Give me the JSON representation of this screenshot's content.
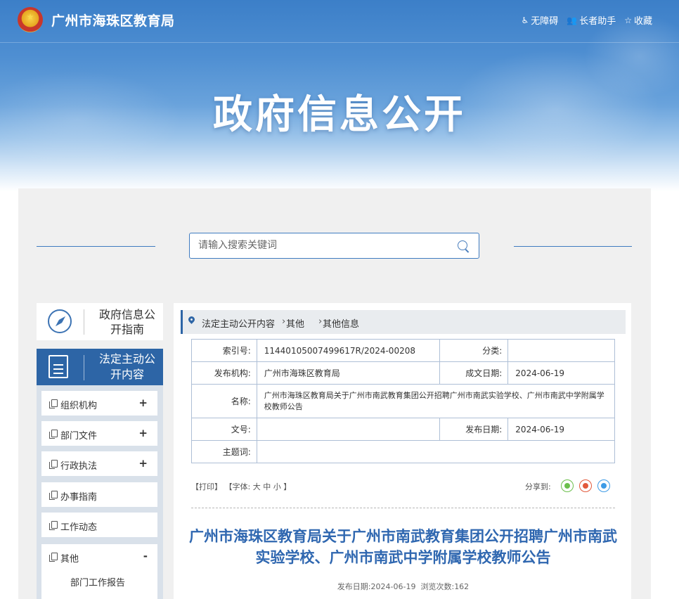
{
  "header": {
    "site_title": "广州市海珠区教育局",
    "links": [
      {
        "icon": "wheelchair-icon",
        "glyph": "♿",
        "label": "无障碍"
      },
      {
        "icon": "elder-helper-icon",
        "glyph": "👥",
        "label": "长者助手"
      },
      {
        "icon": "star-icon",
        "glyph": "☆",
        "label": "收藏"
      }
    ],
    "banner_title": "政府信息公开"
  },
  "search": {
    "placeholder": "请输入搜索关键词",
    "value": ""
  },
  "sidebar": {
    "guide_label": "政府信息公开指南",
    "active_label": "法定主动公开内容",
    "items": [
      {
        "label": "组织机构",
        "toggle": "+"
      },
      {
        "label": "部门文件",
        "toggle": "+"
      },
      {
        "label": "行政执法",
        "toggle": "+"
      },
      {
        "label": "办事指南",
        "toggle": ""
      },
      {
        "label": "工作动态",
        "toggle": ""
      },
      {
        "label": "其他",
        "toggle": "-"
      }
    ],
    "sub_items": [
      {
        "label": "部门工作报告"
      }
    ]
  },
  "breadcrumb": [
    "法定主动公开内容",
    "其他",
    "其他信息"
  ],
  "meta": {
    "index_label": "索引号:",
    "index_value": "11440105007499617R/2024-00208",
    "category_label": "分类:",
    "category_value": "",
    "publisher_label": "发布机构:",
    "publisher_value": "广州市海珠区教育局",
    "created_label": "成文日期:",
    "created_value": "2024-06-19",
    "name_label": "名称:",
    "name_value": "广州市海珠区教育局关于广州市南武教育集团公开招聘广州市南武实验学校、广州市南武中学附属学校教师公告",
    "docno_label": "文号:",
    "docno_value": "",
    "published_label": "发布日期:",
    "published_value": "2024-06-19",
    "subject_label": "主题词:",
    "subject_value": ""
  },
  "tools": {
    "print": "【打印】",
    "font_prefix": "【字体:",
    "font_large": "大",
    "font_medium": "中",
    "font_small": "小",
    "font_suffix": "】",
    "share_label": "分享到:"
  },
  "share_icons": [
    "wechat-icon",
    "weibo-icon",
    "qq-icon"
  ],
  "colors": {
    "brand_blue": "#2d65a6",
    "title_blue": "#2f67b0",
    "wechat": "#6bbf4c",
    "weibo": "#e2593b",
    "qq": "#3e9be6"
  },
  "article": {
    "title": "广州市海珠区教育局关于广州市南武教育集团公开招聘广州市南武实验学校、广州市南武中学附属学校教师公告",
    "date_label": "发布日期:",
    "date_value": "2024-06-19",
    "views_label": "浏览次数:",
    "views_value": "162"
  }
}
